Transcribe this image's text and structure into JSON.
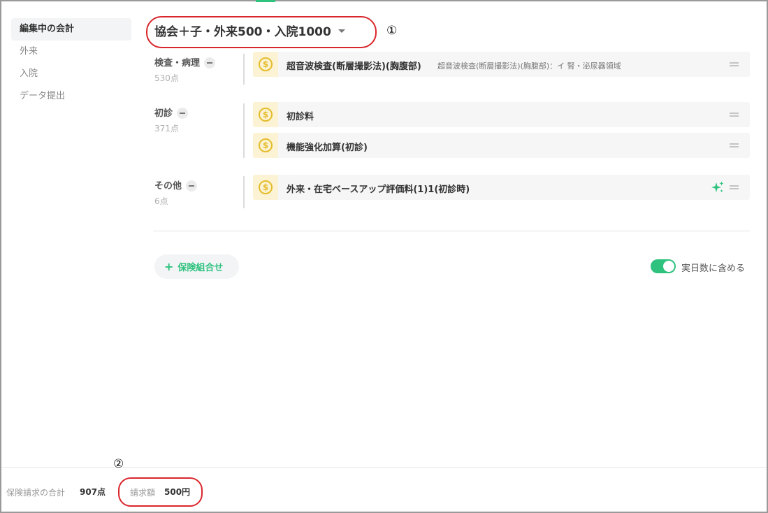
{
  "sidebar": {
    "items": [
      {
        "label": "編集中の会計",
        "active": true
      },
      {
        "label": "外来",
        "active": false
      },
      {
        "label": "入院",
        "active": false
      },
      {
        "label": "データ提出",
        "active": false
      }
    ]
  },
  "header": {
    "title": "協会＋子・外来500・入院1000",
    "annotation_1": "①"
  },
  "groups": [
    {
      "label": "検査・病理",
      "points": "530点",
      "items": [
        {
          "name": "超音波検査(断層撮影法)(胸腹部)",
          "description": "超音波検査(断層撮影法)(胸腹部)：イ 腎・泌尿器領域"
        }
      ]
    },
    {
      "label": "初診",
      "points": "371点",
      "items": [
        {
          "name": "初診料"
        },
        {
          "name": "機能強化加算(初診)"
        }
      ]
    },
    {
      "label": "その他",
      "points": "6点",
      "items": [
        {
          "name": "外来・在宅ベースアップ評価料(1)1(初診時)"
        }
      ]
    }
  ],
  "coin_symbol": "$",
  "add_insurance_button": {
    "icon": "+",
    "label": "保険組合せ"
  },
  "real_days_toggle": {
    "label": "実日数に含める",
    "on": true
  },
  "footer": {
    "insurance_total_label": "保険請求の合計",
    "insurance_total_value": "907点",
    "billing_label": "請求額",
    "billing_value": "500円",
    "annotation_2": "②"
  },
  "colors": {
    "accent": "#2ec27e",
    "annotation": "#d9262c",
    "coin": "#e5bc2c"
  }
}
